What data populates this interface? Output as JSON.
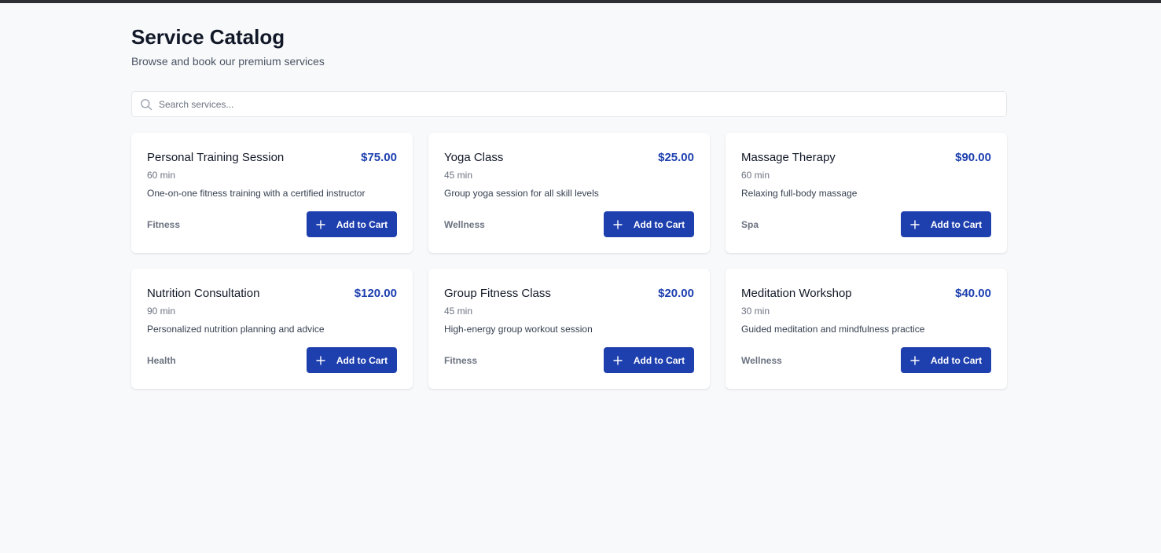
{
  "header": {
    "title": "Service Catalog",
    "subtitle": "Browse and book our premium services"
  },
  "search": {
    "placeholder": "Search services...",
    "value": "",
    "icon": "search-icon"
  },
  "colors": {
    "accent": "#1e3fae",
    "price": "#1e40af",
    "background": "#f8f9fb"
  },
  "services": [
    {
      "title": "Personal Training Session",
      "price": "$75.00",
      "duration": "60 min",
      "description": "One-on-one fitness training with a certified instructor",
      "category": "Fitness",
      "button_label": "Add to Cart"
    },
    {
      "title": "Yoga Class",
      "price": "$25.00",
      "duration": "45 min",
      "description": "Group yoga session for all skill levels",
      "category": "Wellness",
      "button_label": "Add to Cart"
    },
    {
      "title": "Massage Therapy",
      "price": "$90.00",
      "duration": "60 min",
      "description": "Relaxing full-body massage",
      "category": "Spa",
      "button_label": "Add to Cart"
    },
    {
      "title": "Nutrition Consultation",
      "price": "$120.00",
      "duration": "90 min",
      "description": "Personalized nutrition planning and advice",
      "category": "Health",
      "button_label": "Add to Cart"
    },
    {
      "title": "Group Fitness Class",
      "price": "$20.00",
      "duration": "45 min",
      "description": "High-energy group workout session",
      "category": "Fitness",
      "button_label": "Add to Cart"
    },
    {
      "title": "Meditation Workshop",
      "price": "$40.00",
      "duration": "30 min",
      "description": "Guided meditation and mindfulness practice",
      "category": "Wellness",
      "button_label": "Add to Cart"
    }
  ]
}
